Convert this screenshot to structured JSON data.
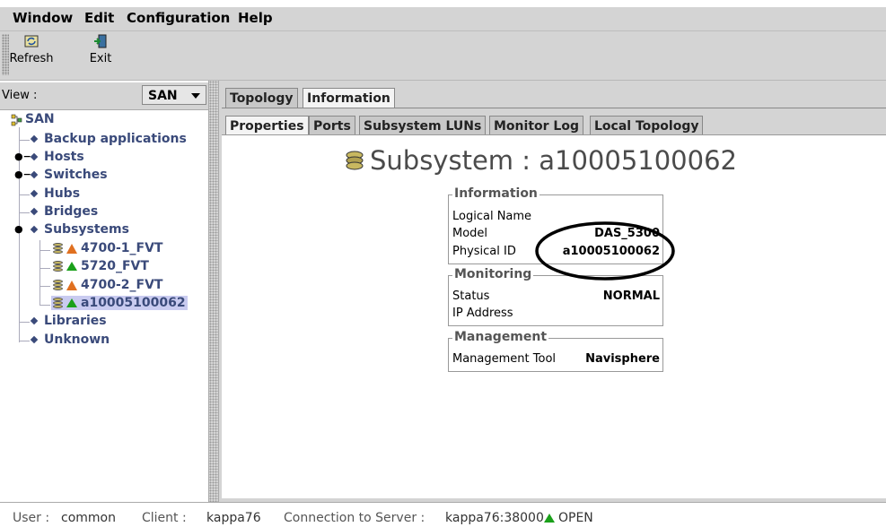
{
  "menu": {
    "items": [
      "Window",
      "Edit",
      "Configuration",
      "Help"
    ]
  },
  "toolbar": {
    "refresh_label": "Refresh",
    "exit_label": "Exit"
  },
  "view": {
    "label": "View :",
    "selected": "SAN"
  },
  "tree": {
    "root": "SAN",
    "items": [
      "Backup applications",
      "Hosts",
      "Switches",
      "Hubs",
      "Bridges",
      "Subsystems",
      "Libraries",
      "Unknown"
    ],
    "subsystems": [
      {
        "name": "4700-1_FVT",
        "status": "warning"
      },
      {
        "name": "5720_FVT",
        "status": "ok"
      },
      {
        "name": "4700-2_FVT",
        "status": "warning"
      },
      {
        "name": "a10005100062",
        "status": "ok",
        "selected": true
      }
    ]
  },
  "tabs": {
    "top": [
      "Topology",
      "Information"
    ],
    "top_selected": "Information",
    "sub": [
      "Properties",
      "Ports",
      "Subsystem LUNs",
      "Monitor Log",
      "Local Topology"
    ],
    "sub_selected": "Properties"
  },
  "detail": {
    "title": "Subsystem : a10005100062",
    "information": {
      "legend": "Information",
      "logical_name_label": "Logical Name",
      "logical_name_value": "",
      "model_label": "Model",
      "model_value": "DAS_5300",
      "physical_id_label": "Physical ID",
      "physical_id_value": "a10005100062"
    },
    "monitoring": {
      "legend": "Monitoring",
      "status_label": "Status",
      "status_value": "NORMAL",
      "ip_label": "IP Address",
      "ip_value": ""
    },
    "management": {
      "legend": "Management",
      "tool_label": "Management Tool",
      "tool_value": "Navisphere"
    }
  },
  "status": {
    "user_label": "User :",
    "user_value": "common",
    "client_label": "Client :",
    "client_value": "kappa76",
    "connection_label": "Connection to Server :",
    "connection_value": "kappa76:38000",
    "connection_state": "OPEN"
  },
  "colors": {
    "warning": "#e07020",
    "ok": "#1aa01a",
    "tree_text": "#3a4a7a",
    "selection": "#c9cbf0"
  }
}
